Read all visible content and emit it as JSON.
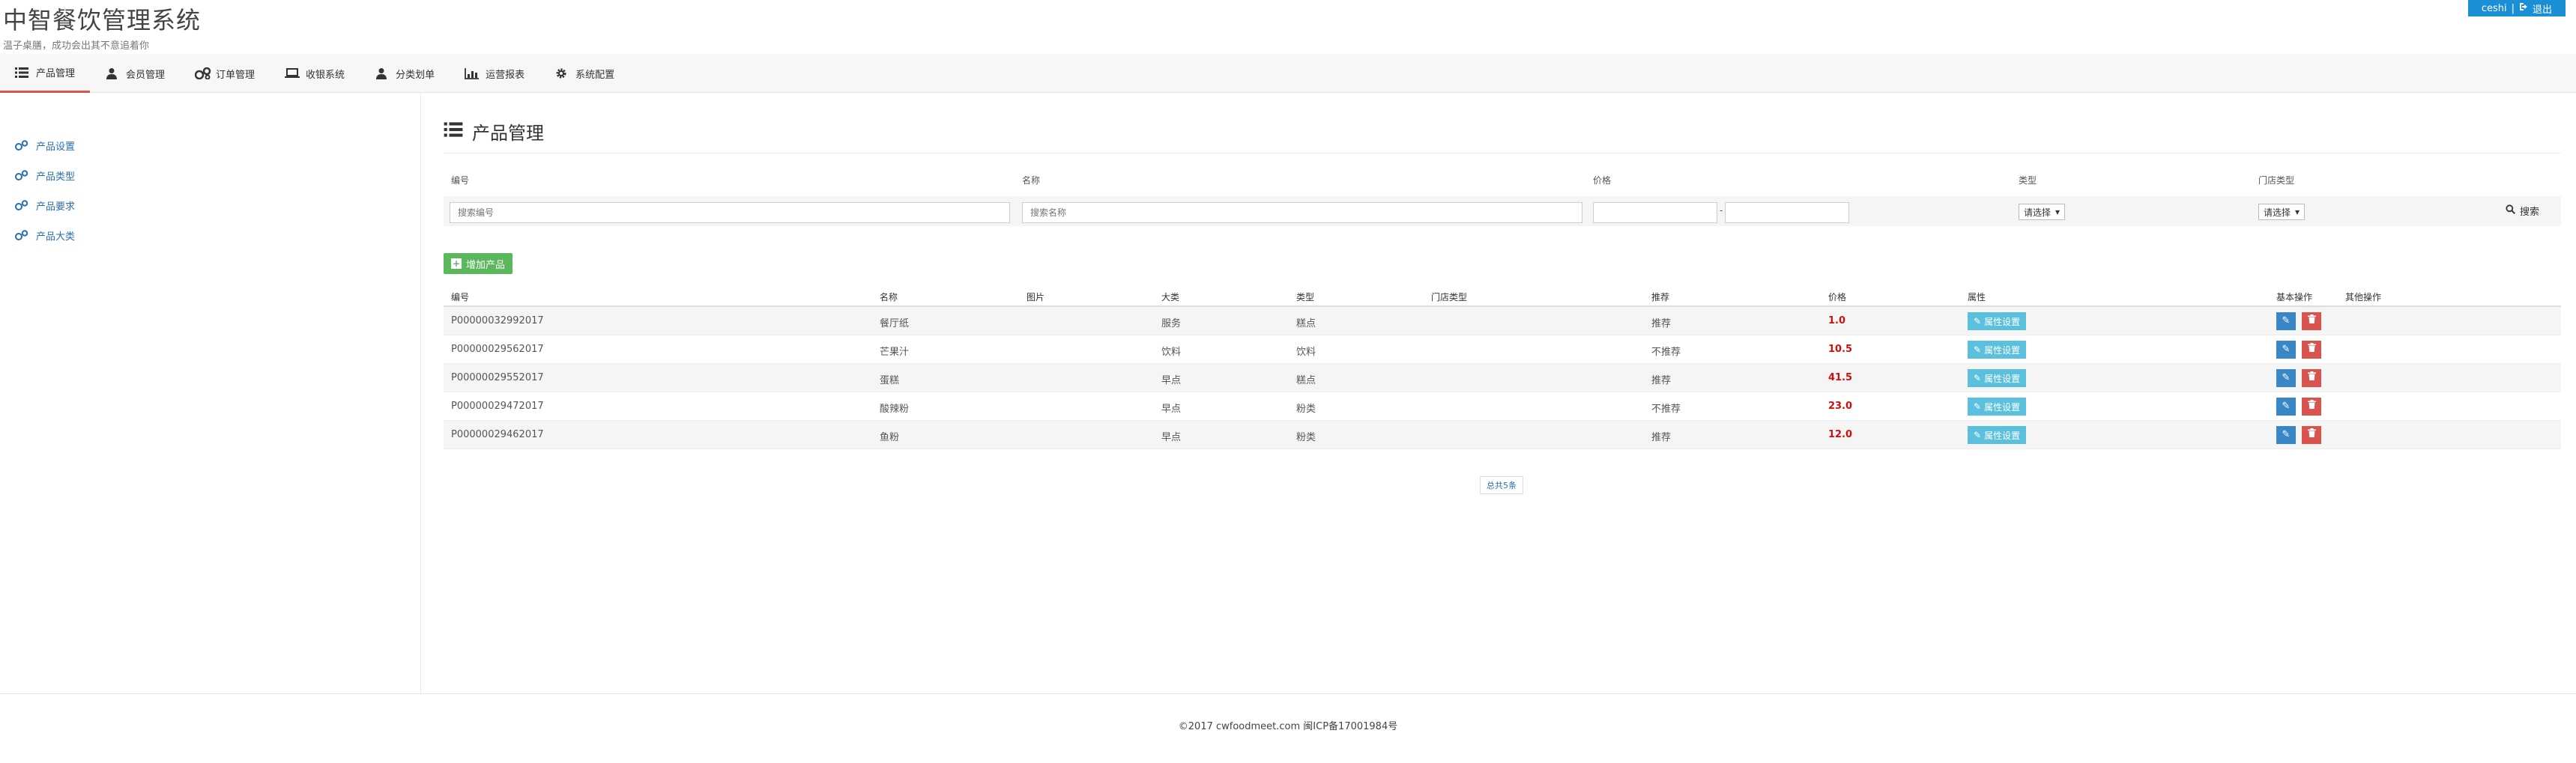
{
  "header": {
    "title": "中智餐饮管理系统",
    "subtitle": "温子桌膳，成功会出其不意追着你",
    "user_name": "ceshi",
    "separator": "|",
    "logout_label": "退出"
  },
  "navbar": {
    "items": [
      {
        "label": "产品管理",
        "icon": "list-icon",
        "active": true
      },
      {
        "label": "会员管理",
        "icon": "user-icon"
      },
      {
        "label": "订单管理",
        "icon": "cogs-icon"
      },
      {
        "label": "收银系统",
        "icon": "laptop-icon"
      },
      {
        "label": "分类划单",
        "icon": "user-icon"
      },
      {
        "label": "运营报表",
        "icon": "bar-chart-icon"
      },
      {
        "label": "系统配置",
        "icon": "gear-icon"
      }
    ]
  },
  "sidebar": {
    "items": [
      {
        "label": "产品设置",
        "icon": "cogs-icon"
      },
      {
        "label": "产品类型",
        "icon": "cogs-icon"
      },
      {
        "label": "产品要求",
        "icon": "cogs-icon"
      },
      {
        "label": "产品大类",
        "icon": "cogs-icon"
      }
    ]
  },
  "main": {
    "title": "产品管理",
    "filters": {
      "labels": {
        "code": "编号",
        "name": "名称",
        "price": "价格",
        "type": "类型",
        "store_type": "门店类型"
      },
      "code_placeholder": "搜索编号",
      "name_placeholder": "搜索名称",
      "price_min": "",
      "price_max": "",
      "price_separator": "-",
      "type_select": "请选择",
      "store_type_select": "请选择",
      "search_label": "搜索"
    },
    "add_button": "增加产品",
    "table": {
      "columns": {
        "code": "编号",
        "name": "名称",
        "image": "图片",
        "category": "大类",
        "type": "类型",
        "store_type": "门店类型",
        "recommend": "推荐",
        "price": "价格",
        "attribute": "属性",
        "basic_ops": "基本操作",
        "other_ops": "其他操作"
      },
      "attr_button": "属性设置",
      "rows": [
        {
          "code": "P00000032992017",
          "name": "餐厅纸",
          "category": "服务",
          "type": "糕点",
          "recommend": "推荐",
          "price": "1.0"
        },
        {
          "code": "P00000029562017",
          "name": "芒果汁",
          "category": "饮料",
          "type": "饮料",
          "recommend": "不推荐",
          "price": "10.5"
        },
        {
          "code": "P00000029552017",
          "name": "蛋糕",
          "category": "早点",
          "type": "糕点",
          "recommend": "推荐",
          "price": "41.5"
        },
        {
          "code": "P00000029472017",
          "name": "酸辣粉",
          "category": "早点",
          "type": "粉类",
          "recommend": "不推荐",
          "price": "23.0"
        },
        {
          "code": "P00000029462017",
          "name": "鱼粉",
          "category": "早点",
          "type": "粉类",
          "recommend": "推荐",
          "price": "12.0"
        }
      ]
    },
    "pager_text": "总共5条"
  },
  "footer": {
    "text": "©2017 cwfoodmeet.com 闽ICP备17001984号"
  }
}
